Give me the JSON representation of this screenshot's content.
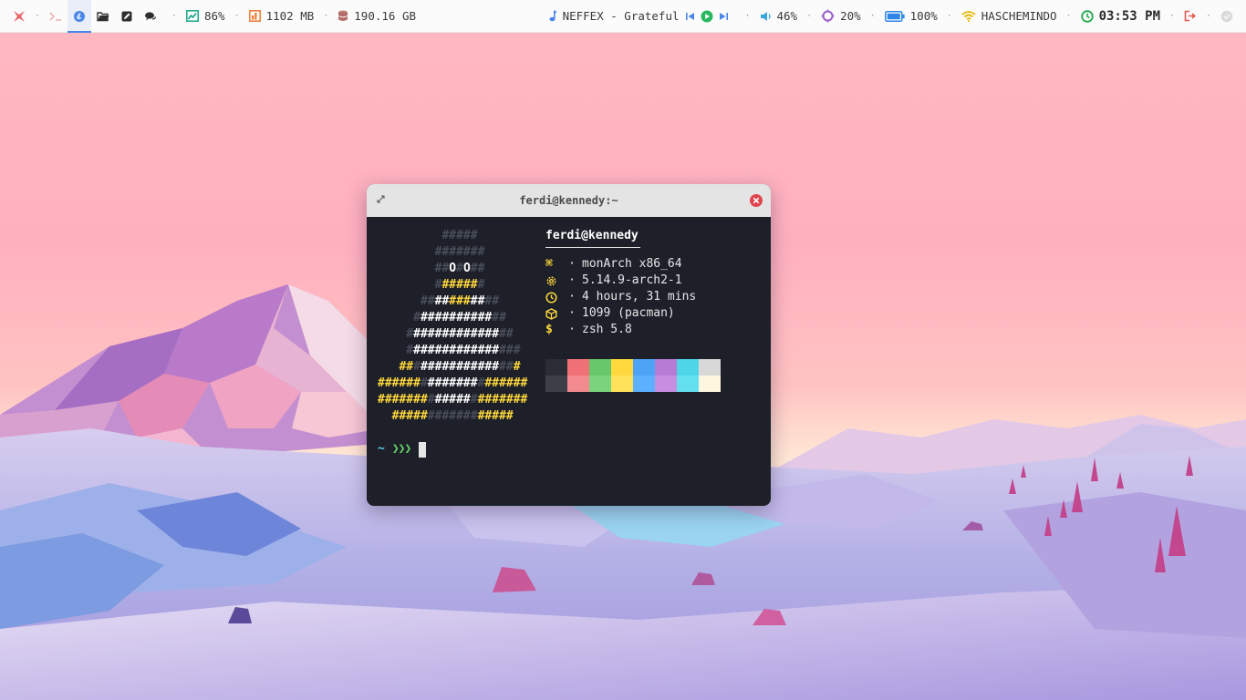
{
  "topbar": {
    "workspaces": [
      {
        "name": "terminal",
        "active": false
      },
      {
        "name": "browser",
        "active": true
      },
      {
        "name": "files",
        "active": false
      },
      {
        "name": "editor",
        "active": false
      },
      {
        "name": "chat",
        "active": false
      }
    ],
    "sep": "·",
    "cpu": "86%",
    "memory": "1102 MB",
    "disk": "190.16 GB",
    "now_playing": "NEFFEX - Grateful",
    "volume": "46%",
    "brightness": "20%",
    "battery": "100%",
    "wifi": "HASCHEMINDO",
    "time": "03:53 PM"
  },
  "terminal": {
    "title": "ferdi@kennedy:~",
    "user_host": "ferdi@kennedy",
    "info": [
      {
        "icon": "command-icon",
        "text": "monArch x86_64"
      },
      {
        "icon": "gear-icon",
        "text": "5.14.9-arch2-1"
      },
      {
        "icon": "clock-icon",
        "text": "4 hours, 31 mins"
      },
      {
        "icon": "package-icon",
        "text": "1099 (pacman)"
      },
      {
        "icon": "dollar-icon",
        "text": "zsh 5.8"
      }
    ],
    "info_dot": "·",
    "palette_top": [
      "#2a2d36",
      "#f07178",
      "#66c86a",
      "#ffd83d",
      "#4da3f5",
      "#b77bd6",
      "#4fd6e6",
      "#d8d8d8"
    ],
    "palette_bottom": [
      "#3c3f48",
      "#f38a8f",
      "#7ad47c",
      "#ffe15a",
      "#5cb0ff",
      "#c78ee0",
      "#62e0ee",
      "#fff6df"
    ],
    "prompt_tilde": "~",
    "prompt_arrows": "❯❯❯"
  },
  "colors": {
    "accent": "#4a86e8",
    "ascii_yellow": "#ffd83d",
    "terminal_bg": "#1d2029",
    "close_red": "#e0454f"
  }
}
